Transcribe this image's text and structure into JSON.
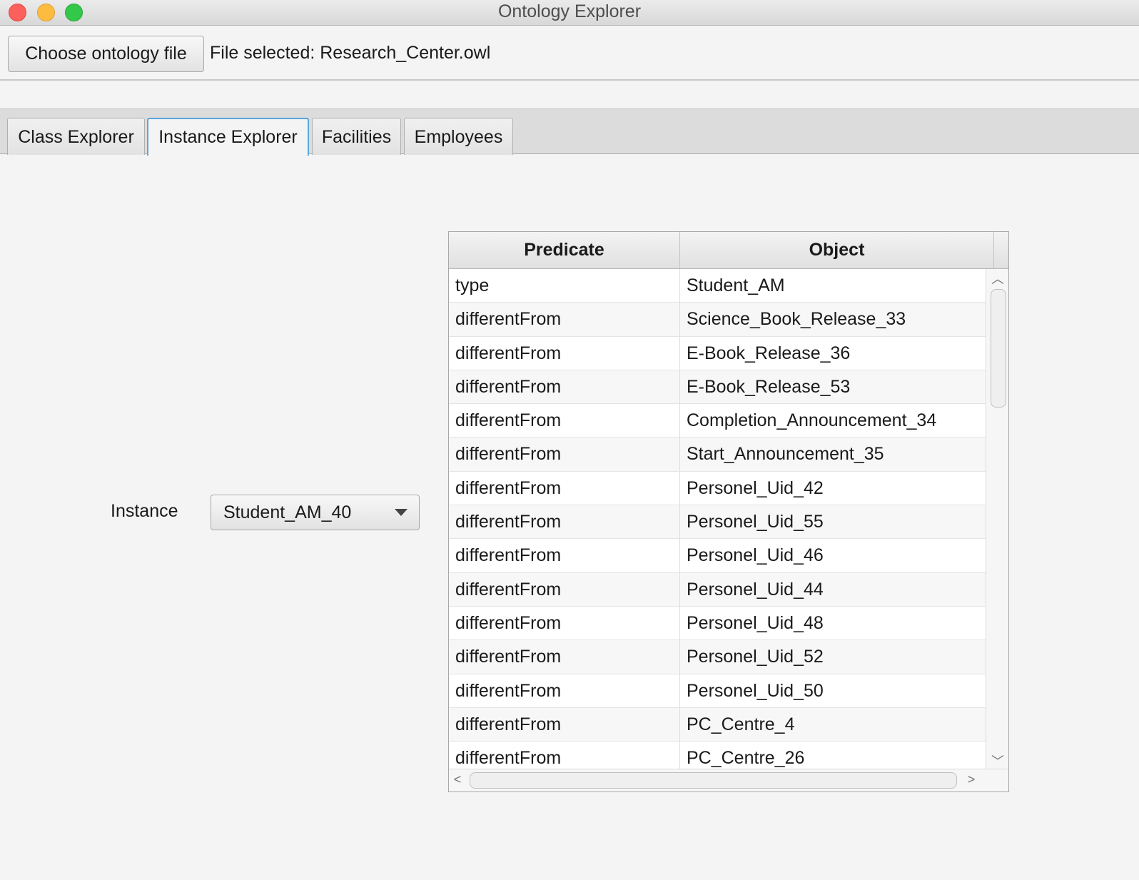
{
  "window": {
    "title": "Ontology Explorer"
  },
  "toolbar": {
    "choose_button_label": "Choose ontology file",
    "file_selected_text": "File selected: Research_Center.owl"
  },
  "tabs": [
    {
      "label": "Class Explorer",
      "selected": false
    },
    {
      "label": "Instance Explorer",
      "selected": true
    },
    {
      "label": "Facilities",
      "selected": false
    },
    {
      "label": "Employees",
      "selected": false
    }
  ],
  "instance_panel": {
    "label": "Instance",
    "selected_instance": "Student_AM_40"
  },
  "table": {
    "columns": [
      "Predicate",
      "Object"
    ],
    "rows": [
      {
        "predicate": "type",
        "object": "Student_AM"
      },
      {
        "predicate": "differentFrom",
        "object": "Science_Book_Release_33"
      },
      {
        "predicate": "differentFrom",
        "object": "E-Book_Release_36"
      },
      {
        "predicate": "differentFrom",
        "object": "E-Book_Release_53"
      },
      {
        "predicate": "differentFrom",
        "object": "Completion_Announcement_34"
      },
      {
        "predicate": "differentFrom",
        "object": "Start_Announcement_35"
      },
      {
        "predicate": "differentFrom",
        "object": "Personel_Uid_42"
      },
      {
        "predicate": "differentFrom",
        "object": "Personel_Uid_55"
      },
      {
        "predicate": "differentFrom",
        "object": "Personel_Uid_46"
      },
      {
        "predicate": "differentFrom",
        "object": "Personel_Uid_44"
      },
      {
        "predicate": "differentFrom",
        "object": "Personel_Uid_48"
      },
      {
        "predicate": "differentFrom",
        "object": "Personel_Uid_52"
      },
      {
        "predicate": "differentFrom",
        "object": "Personel_Uid_50"
      },
      {
        "predicate": "differentFrom",
        "object": "PC_Centre_4"
      },
      {
        "predicate": "differentFrom",
        "object": "PC_Centre_26"
      }
    ]
  },
  "icons": {
    "close": "close-icon",
    "minimize": "minimize-icon",
    "zoom": "zoom-icon",
    "dropdown": "chevron-down-icon",
    "scroll_up": "chevron-up-icon",
    "scroll_down": "chevron-down-icon",
    "scroll_left": "chevron-left-icon",
    "scroll_right": "chevron-right-icon"
  },
  "colors": {
    "traffic_close": "#fc605c",
    "traffic_minimize": "#fdbc40",
    "traffic_zoom": "#34c84a",
    "tab_focus": "#5aa6dd"
  }
}
